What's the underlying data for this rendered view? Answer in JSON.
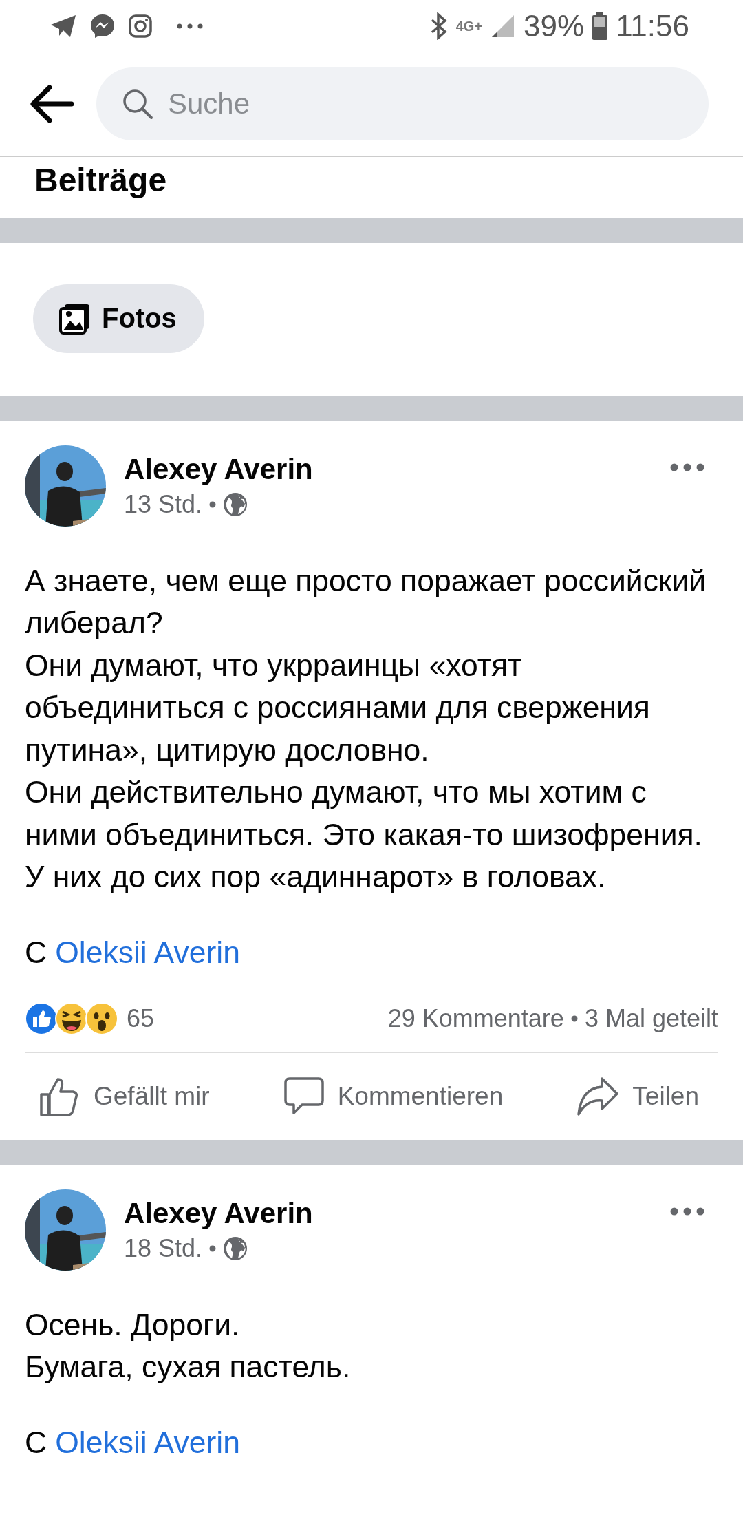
{
  "status_bar": {
    "network": "4G+",
    "battery": "39%",
    "time": "11:56"
  },
  "header": {
    "search": {
      "placeholder": "Suche"
    }
  },
  "section_title": "Beiträge",
  "filters": [
    {
      "label": "Fotos"
    }
  ],
  "posts": [
    {
      "author": "Alexey Averin",
      "time": "13 Std.",
      "body": "А знаете, чем еще просто поражает российский либерал?\nОни думают, что укрраинцы «хотят объединиться с россиянами для свержения путина», цитирую дословно.\nОни действительно думают, что мы хотим с ними объединиться. Это какая-то шизофрения. У них до сих пор «адиннарот» в головах.",
      "credit_prefix": "С",
      "credit_link": "Oleksii Averin",
      "reactions_count": "65",
      "comments": "29 Kommentare",
      "shares": "3 Mal geteilt",
      "actions": [
        "Gefällt mir",
        "Kommentieren",
        "Teilen"
      ]
    },
    {
      "author": "Alexey Averin",
      "time": "18 Std.",
      "body": "Осень. Дороги.\nБумага, сухая пастель.",
      "credit_prefix": "С",
      "credit_link": "Oleksii Averin"
    }
  ]
}
